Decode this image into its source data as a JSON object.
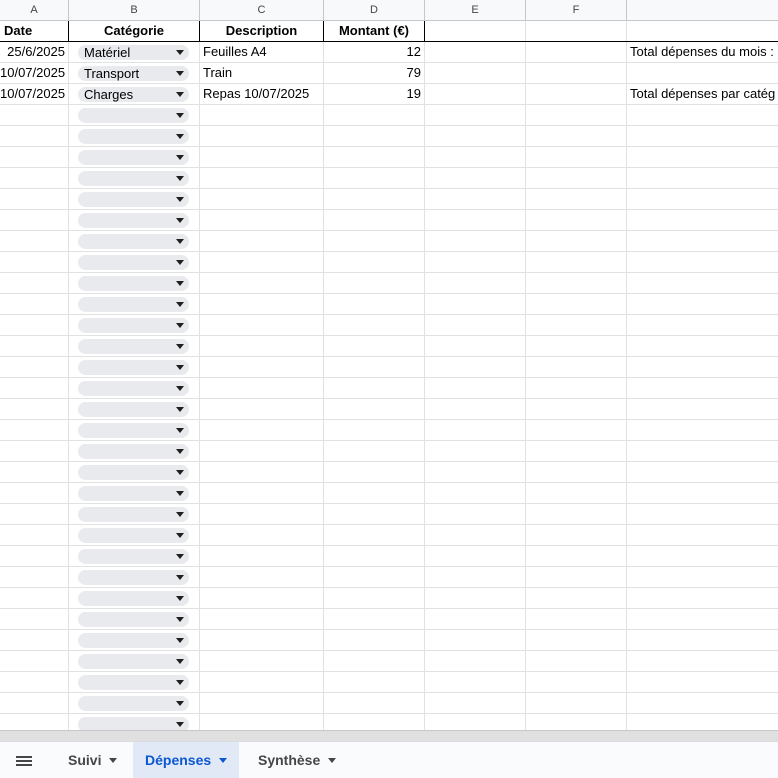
{
  "columns": [
    "A",
    "B",
    "C",
    "D",
    "E",
    "F"
  ],
  "header": {
    "date": "Date",
    "categorie": "Catégorie",
    "description": "Description",
    "montant": "Montant (€)"
  },
  "rows": [
    {
      "date": "25/6/2025",
      "categorie": "Matériel",
      "description": "Feuilles A4",
      "montant": "12",
      "note": "Total dépenses du mois :"
    },
    {
      "date": "10/07/2025",
      "categorie": "Transport",
      "description": "Train",
      "montant": "79",
      "note": ""
    },
    {
      "date": "10/07/2025",
      "categorie": "Charges",
      "description": "Repas 10/07/2025",
      "montant": "19",
      "note": "Total dépenses par catég"
    }
  ],
  "empty_dropdown_rows": 30,
  "sheet_tabs": [
    {
      "label": "Suivi",
      "active": false
    },
    {
      "label": "Dépenses",
      "active": true
    },
    {
      "label": "Synthèse",
      "active": false
    }
  ],
  "colors": {
    "accent": "#0b57d0",
    "chip": "#e8eaed",
    "active_tab_bg": "#e1e9f7"
  }
}
